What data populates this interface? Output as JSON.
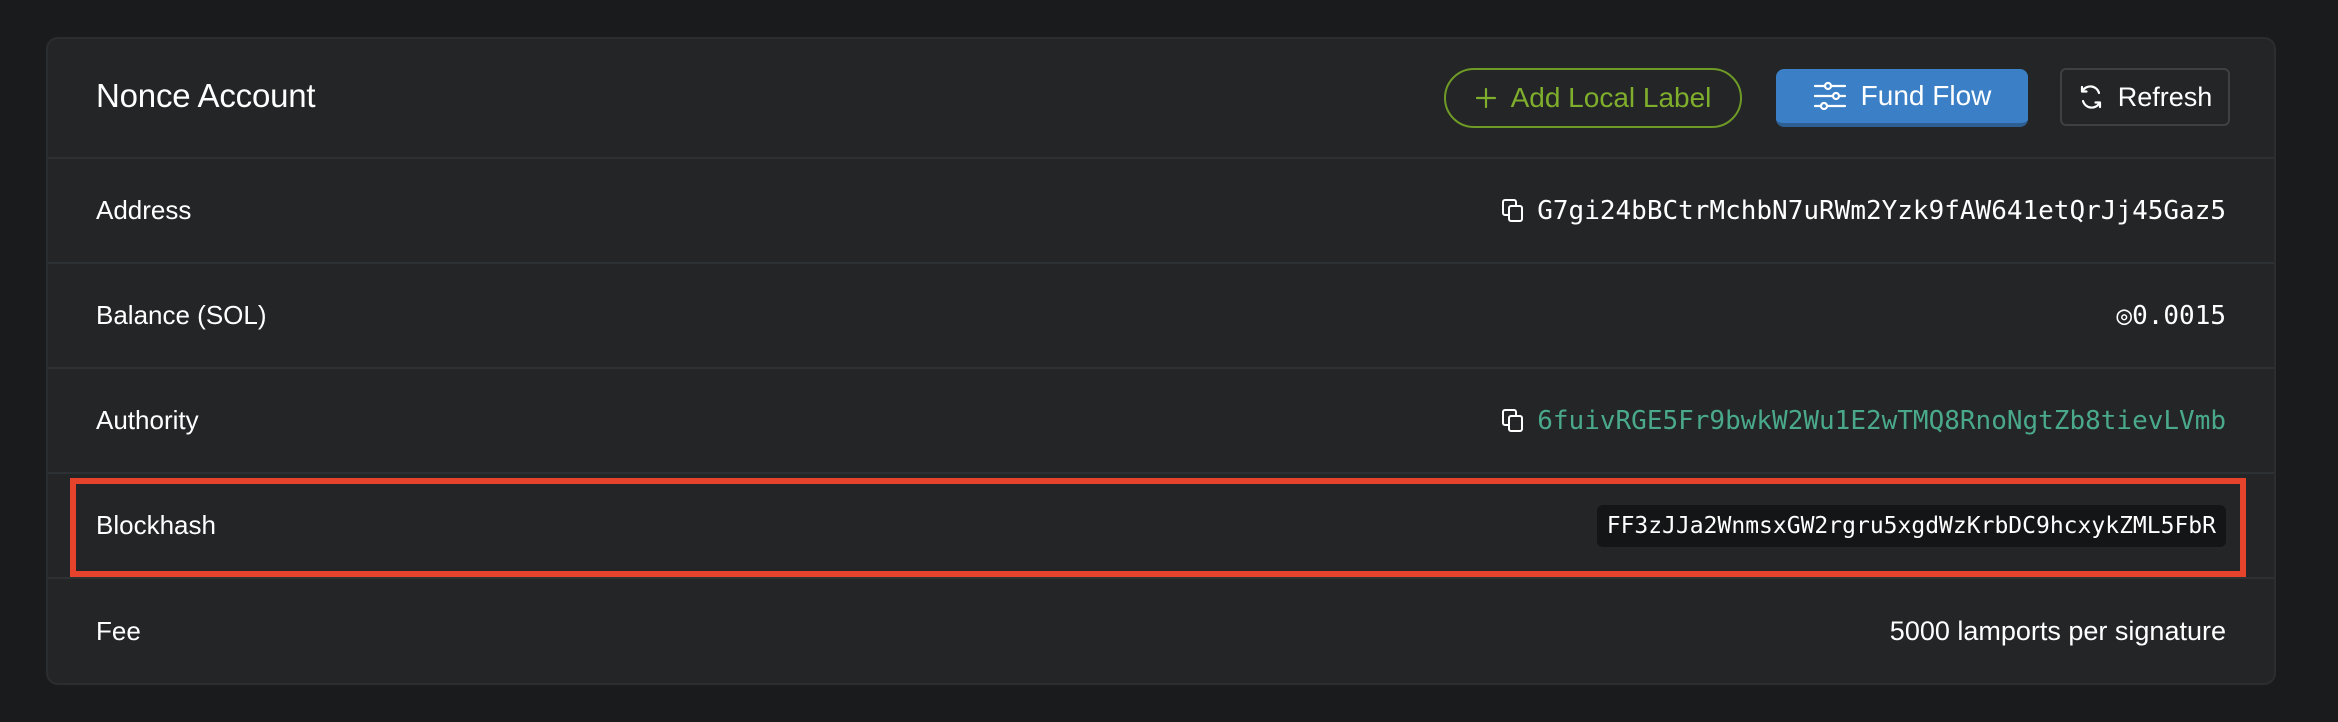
{
  "card": {
    "title": "Nonce Account",
    "buttons": {
      "add_label": "Add Local Label",
      "fund_flow": "Fund Flow",
      "refresh": "Refresh"
    }
  },
  "rows": [
    {
      "label": "Address",
      "value": "G7gi24bBCtrMchbN7uRWm2Yzk9fAW641etQrJj45Gaz5",
      "copyable": true
    },
    {
      "label": "Balance (SOL)",
      "value": "◎0.0015",
      "copyable": false
    },
    {
      "label": "Authority",
      "value": "6fuivRGE5Fr9bwkW2Wu1E2wTMQ8RnoNgtZb8tievLVmb",
      "copyable": true
    },
    {
      "label": "Blockhash",
      "value": "FF3zJJa2WnmsxGW2rgru5xgdWzKrbDC9hcxykZML5FbR",
      "copyable": false
    },
    {
      "label": "Fee",
      "value": "5000 lamports per signature",
      "copyable": false
    }
  ],
  "icons": {
    "plus": "plus-icon",
    "fund_flow": "sliders-icon",
    "refresh": "refresh-icon",
    "copy": "copy-icon"
  },
  "colors": {
    "accent_green": "#7fae2c",
    "primary_blue": "#3b80c6",
    "link_teal": "#4aa98a",
    "highlight_red": "#e5432c"
  }
}
